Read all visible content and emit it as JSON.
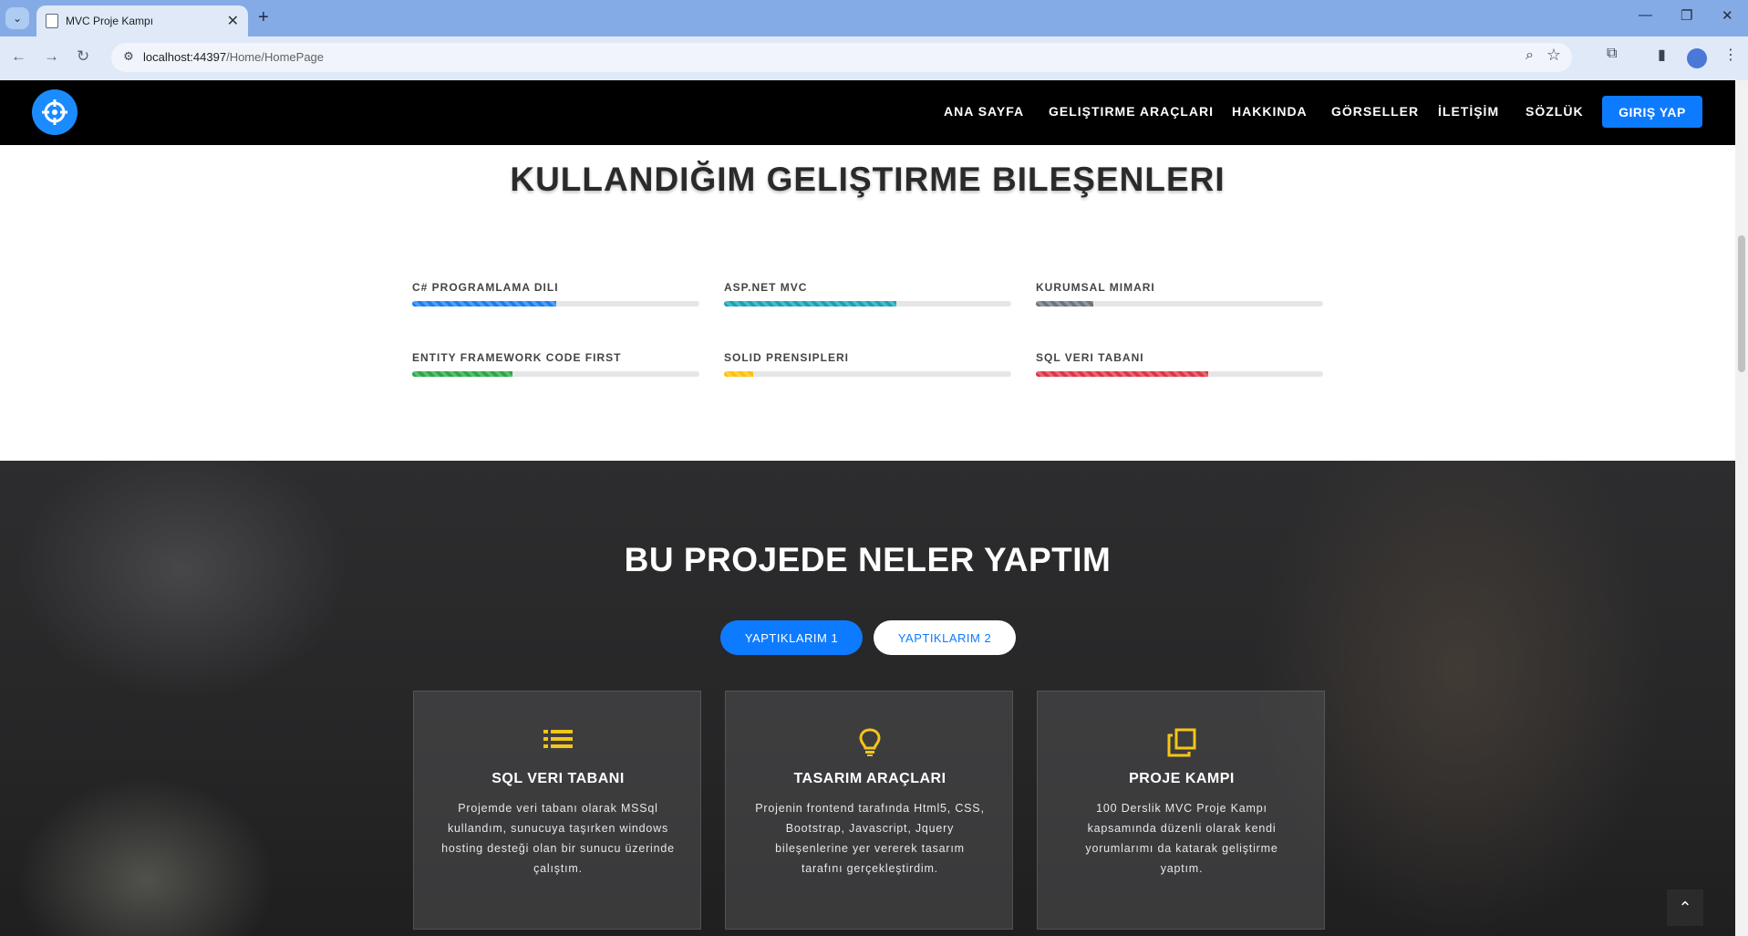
{
  "browser": {
    "tab_title": "MVC Proje Kampı",
    "url_host": "localhost:44397",
    "url_path": "/Home/HomePage"
  },
  "header": {
    "nav": [
      "ANA SAYFA",
      "GELIŞTIRME ARAÇLARI",
      "HAKKINDA",
      "GÖRSELLER",
      "İLETİŞİM",
      "SÖZLÜK"
    ],
    "login_label": "GIRIŞ YAP",
    "accent": "#0d7bff"
  },
  "skills": {
    "title": "KULLANDIĞIM GELIŞTIRME BILEŞENLERI",
    "items": [
      {
        "label": "C# PROGRAMLAMA DILI",
        "percent": 50,
        "color": "#1a7ef2"
      },
      {
        "label": "ASP.NET MVC",
        "percent": 60,
        "color": "#17a2b8"
      },
      {
        "label": "KURUMSAL MIMARI",
        "percent": 20,
        "color": "#6c757d"
      },
      {
        "label": "ENTITY FRAMEWORK CODE FIRST",
        "percent": 35,
        "color": "#28a745"
      },
      {
        "label": "SOLID PRENSIPLERI",
        "percent": 10,
        "color": "#ffc107"
      },
      {
        "label": "SQL VERI TABANI",
        "percent": 60,
        "color": "#dc3545"
      }
    ]
  },
  "projects": {
    "title": "BU PROJEDE NELER YAPTIM",
    "tab1": "YAPTIKLARIM 1",
    "tab2": "YAPTIKLARIM 2",
    "cards": [
      {
        "icon": "list-icon",
        "title": "SQL VERI TABANI",
        "desc": "Projemde veri tabanı olarak MSSql kullandım, sunucuya taşırken windows hosting desteği olan bir sunucu üzerinde çalıştım."
      },
      {
        "icon": "lightbulb-icon",
        "title": "TASARIM ARAÇLARI",
        "desc": "Projenin frontend tarafında Html5, CSS, Bootstrap, Javascript, Jquery bileşenlerine yer vererek tasarım tarafını gerçekleştirdim."
      },
      {
        "icon": "copy-icon",
        "title": "PROJE KAMPI",
        "desc": "100 Derslik MVC Proje Kampı kapsamında düzenli olarak kendi yorumlarımı da katarak geliştirme yaptım."
      }
    ],
    "icon_color": "#f5c518"
  }
}
